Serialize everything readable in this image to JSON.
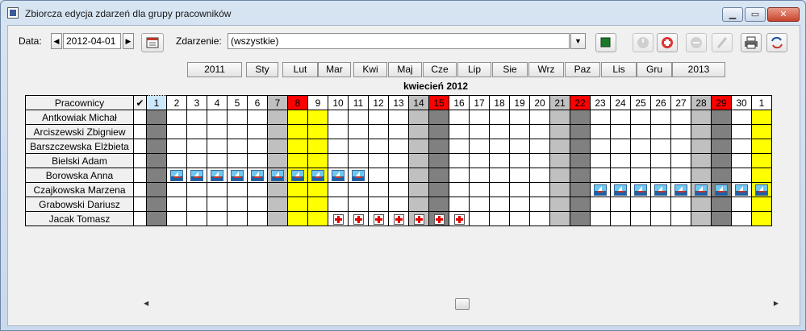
{
  "window": {
    "title": "Zbiorcza edycja zdarzeń dla grupy pracowników"
  },
  "toolbar": {
    "date_label": "Data:",
    "date_value": "2012-04-01",
    "event_label": "Zdarzenie:",
    "event_value": "(wszystkie)"
  },
  "months_nav": [
    "2011",
    "Sty",
    "Lut",
    "Mar",
    "Kwi",
    "Maj",
    "Cze",
    "Lip",
    "Sie",
    "Wrz",
    "Paz",
    "Lis",
    "Gru",
    "2013"
  ],
  "month_title": "kwiecień 2012",
  "grid": {
    "header_name": "Pracownicy",
    "header_check": "✔",
    "days": [
      "1",
      "2",
      "3",
      "4",
      "5",
      "6",
      "7",
      "8",
      "9",
      "10",
      "11",
      "12",
      "13",
      "14",
      "15",
      "16",
      "17",
      "18",
      "19",
      "20",
      "21",
      "22",
      "23",
      "24",
      "25",
      "26",
      "27",
      "28",
      "29",
      "30",
      "1"
    ],
    "day_types": [
      "today-sun",
      "w",
      "w",
      "w",
      "w",
      "w",
      "sat",
      "hol-sun",
      "hol",
      "w",
      "w",
      "w",
      "w",
      "sat",
      "sun-red",
      "w",
      "w",
      "w",
      "w",
      "w",
      "sat",
      "sun-red",
      "w",
      "w",
      "w",
      "w",
      "w",
      "sat",
      "sun-red",
      "w",
      "hol"
    ],
    "employees": [
      {
        "name": "Antkowiak Michał",
        "events": {}
      },
      {
        "name": "Arciszewski Zbigniew",
        "events": {}
      },
      {
        "name": "Barszczewska Elżbieta",
        "events": {}
      },
      {
        "name": "Bielski Adam",
        "events": {}
      },
      {
        "name": "Borowska Anna",
        "events": {
          "2": "vacation",
          "3": "vacation",
          "4": "vacation",
          "5": "vacation",
          "6": "vacation",
          "7": "vacation",
          "8": "vacation",
          "9": "vacation",
          "10": "vacation",
          "11": "vacation"
        }
      },
      {
        "name": "Czajkowska Marzena",
        "events": {
          "23": "vacation",
          "24": "vacation",
          "25": "vacation",
          "26": "vacation",
          "27": "vacation",
          "28": "vacation",
          "29": "vacation",
          "30": "vacation",
          "31": "vacation"
        }
      },
      {
        "name": "Grabowski Dariusz",
        "events": {}
      },
      {
        "name": "Jacak Tomasz",
        "events": {
          "10": "sick",
          "11": "sick",
          "12": "sick",
          "13": "sick",
          "14": "sick",
          "15": "sick",
          "16": "sick"
        }
      }
    ]
  }
}
